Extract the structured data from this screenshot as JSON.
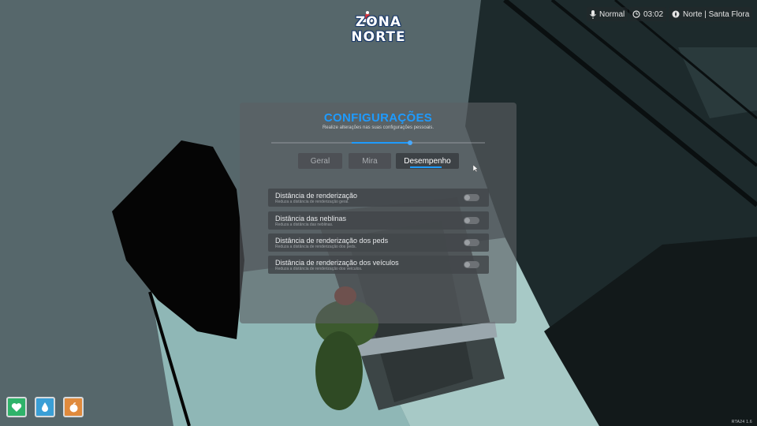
{
  "hud": {
    "brand_line1": "ZONA",
    "brand_line2": "NORTE",
    "voice_mode": "Normal",
    "time": "03:02",
    "location": "Norte | Santa Flora"
  },
  "settings": {
    "title": "CONFIGURAÇÕES",
    "subtitle": "Realize alterações nas suas configurações pessoais.",
    "slider_value_fraction": 0.64,
    "tabs": [
      {
        "label": "Geral",
        "active": false
      },
      {
        "label": "Mira",
        "active": false
      },
      {
        "label": "Desempenho",
        "active": true
      }
    ],
    "options": [
      {
        "title": "Distância de renderização",
        "description": "Reduza a distância de renderização geral.",
        "enabled": false
      },
      {
        "title": "Distância das neblinas",
        "description": "Reduza a distância das neblinas.",
        "enabled": false
      },
      {
        "title": "Distância de renderização dos peds",
        "description": "Reduza a distância de renderização dos peds.",
        "enabled": false
      },
      {
        "title": "Distância de renderização dos veículos",
        "description": "Reduza a distância de renderização dos veículos.",
        "enabled": false
      }
    ]
  },
  "status": {
    "icons": [
      "heart-icon",
      "water-drop-icon",
      "food-icon"
    ],
    "colors": {
      "health": "#2fb36a",
      "thirst": "#3a9fd6",
      "hunger": "#e08a3c"
    }
  },
  "footer": {
    "version": "RTA24 1.6"
  },
  "colors": {
    "accent": "#1e9bff",
    "panel_bg": "#5c6064"
  }
}
